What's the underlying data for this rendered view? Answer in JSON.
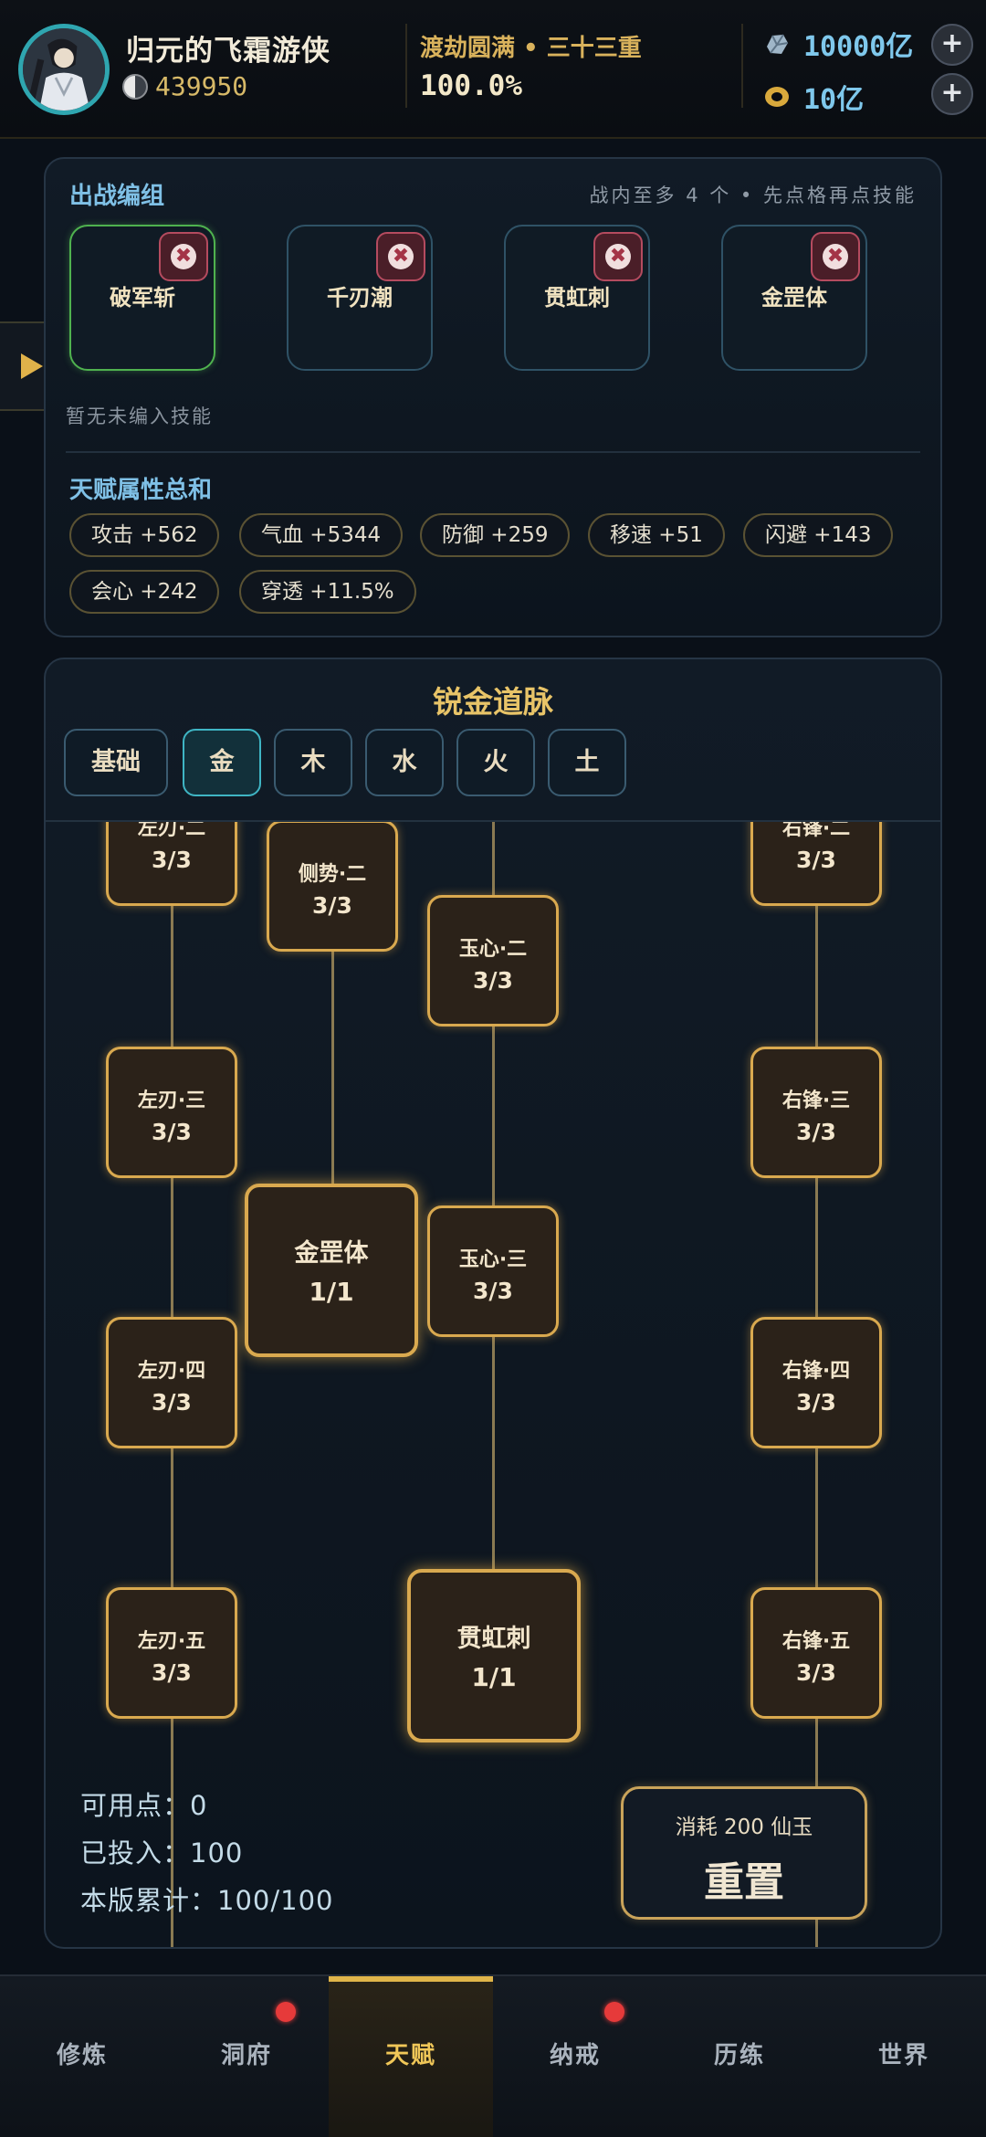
{
  "player": {
    "name": "归元的飞霜游侠",
    "power": "439950",
    "realm": "渡劫圆满 • 三十三重",
    "progress": "100.0%"
  },
  "currency": {
    "spirit_stone": "10000亿",
    "coin": "10亿",
    "plus_label": "+"
  },
  "battle": {
    "title": "出战编组",
    "hint": "战内至多 4 个 • 先点格再点技能",
    "slots": [
      "破军斩",
      "千刃潮",
      "贯虹刺",
      "金罡体"
    ],
    "remove_label": "✖",
    "empty_hint": "暂无未编入技能"
  },
  "talent_stats": {
    "title": "天赋属性总和",
    "chips": [
      "攻击 +562",
      "气血 +5344",
      "防御 +259",
      "移速 +51",
      "闪避 +143",
      "会心 +242",
      "穿透 +11.5%"
    ]
  },
  "tree": {
    "title": "锐金道脉",
    "tabs": [
      "基础",
      "金",
      "木",
      "水",
      "火",
      "土"
    ],
    "selected_tab": "金",
    "nodes": [
      {
        "name": "左刃·二",
        "level": "3/3"
      },
      {
        "name": "侧势·二",
        "level": "3/3"
      },
      {
        "name": "玉心·二",
        "level": "3/3"
      },
      {
        "name": "右锋·二",
        "level": "3/3"
      },
      {
        "name": "左刃·三",
        "level": "3/3"
      },
      {
        "name": "右锋·三",
        "level": "3/3"
      },
      {
        "name": "金罡体",
        "level": "1/1"
      },
      {
        "name": "玉心·三",
        "level": "3/3"
      },
      {
        "name": "左刃·四",
        "level": "3/3"
      },
      {
        "name": "右锋·四",
        "level": "3/3"
      },
      {
        "name": "左刃·五",
        "level": "3/3"
      },
      {
        "name": "贯虹刺",
        "level": "1/1"
      },
      {
        "name": "右锋·五",
        "level": "3/3"
      }
    ],
    "available_points": "可用点：0",
    "invested": "已投入：100",
    "version_total": "本版累计：100/100",
    "reset_cost": "消耗 200 仙玉",
    "reset_label": "重置"
  },
  "nav": {
    "items": [
      "修炼",
      "洞府",
      "天赋",
      "纳戒",
      "历练",
      "世界"
    ],
    "active": "天赋"
  },
  "colors": {
    "accent_gold": "#e0b54a",
    "active_slot_border": "#4fb24f",
    "notification_dot": "#e63a3a"
  }
}
